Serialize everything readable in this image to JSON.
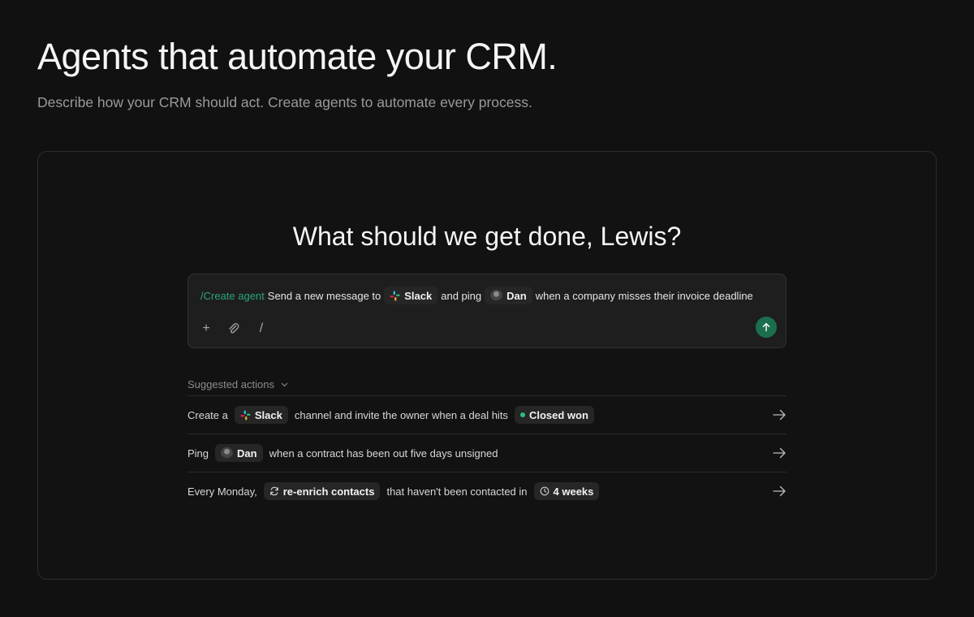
{
  "hero": {
    "title": "Agents that automate your CRM.",
    "subtitle": "Describe how your CRM should act. Create agents to automate every process."
  },
  "panel": {
    "greeting": "What should we get done, Lewis?"
  },
  "composer": {
    "command": "/Create agent",
    "text_1": "Send a new message to",
    "chip_1": "Slack",
    "text_2": "and ping",
    "chip_2": "Dan",
    "text_3": "when a company misses their invoice deadline",
    "tools": {
      "add_icon": "+",
      "attach_icon": "paperclip-icon",
      "slash": "/"
    },
    "send_icon": "arrow-up-icon",
    "accent": "#1b6f4f"
  },
  "suggestions": {
    "header": "Suggested actions",
    "rows": [
      {
        "pre": "Create a",
        "chip": "Slack",
        "mid": "channel and invite the owner when a deal hits",
        "status_chip": "Closed won"
      },
      {
        "pre": "Ping",
        "chip": "Dan",
        "mid": "when a contract has been out five days unsigned"
      },
      {
        "pre": "Every Monday,",
        "chip": "re-enrich contacts",
        "mid": "that haven't been contacted in",
        "time_chip": "4 weeks"
      }
    ]
  },
  "colors": {
    "background": "#111111",
    "command": "#2aa37a",
    "status_dot": "#2bbf7e"
  }
}
